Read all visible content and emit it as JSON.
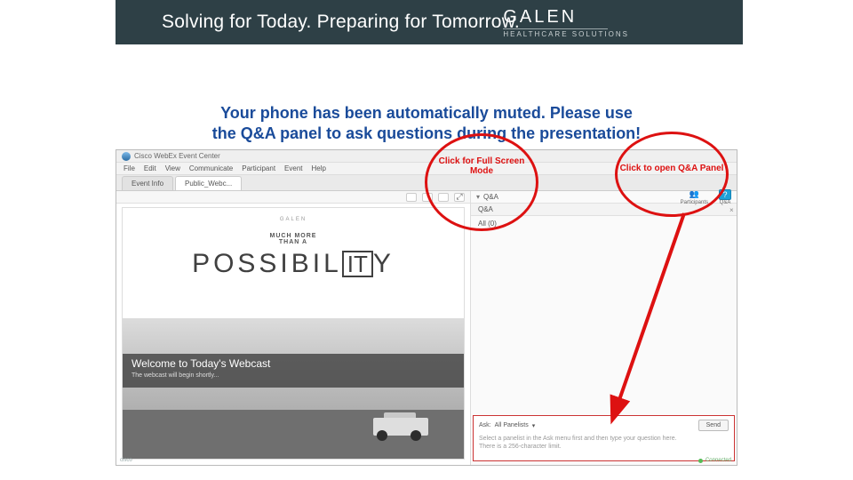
{
  "header": {
    "title": "Solving for Today. Preparing for Tomorrow.",
    "logo_name": "GALEN",
    "logo_sub": "HEALTHCARE SOLUTIONS"
  },
  "instruction": {
    "line1": "Your phone has been automatically muted. Please use",
    "line2": "the Q&A panel to ask questions during the presentation!"
  },
  "window": {
    "title": "Cisco WebEx Event Center"
  },
  "menu": {
    "file": "File",
    "edit": "Edit",
    "view": "View",
    "comm": "Communicate",
    "part": "Participant",
    "event": "Event",
    "help": "Help"
  },
  "tabs": {
    "event_info": "Event Info",
    "public": "Public_Webc..."
  },
  "slide": {
    "brand": "GALEN",
    "much": "MUCH MORE",
    "than": "THAN A",
    "poss_left": "POSSIBIL",
    "poss_box": "IT",
    "poss_right": "Y",
    "welcome": "Welcome to Today's Webcast",
    "sub": "The webcast will begin shortly..."
  },
  "side": {
    "qa_label": "Q&A",
    "qa_icon": "?",
    "participants_label": "Participants",
    "all": "All (0)",
    "qa_header_close": "×"
  },
  "ask": {
    "label": "Ask:",
    "target": "All Panelists",
    "placeholder1": "Select a panelist in the Ask menu first and then type your question here.",
    "placeholder2": "There is a 256-character limit.",
    "send": "Send"
  },
  "footer": {
    "cisco": "cisco",
    "connected": "Connected"
  },
  "annotations": {
    "fullscreen": "Click for Full Screen Mode",
    "qapanel": "Click to open Q&A Panel"
  },
  "toolbar": {
    "fullscreen_glyph": "⤢"
  }
}
